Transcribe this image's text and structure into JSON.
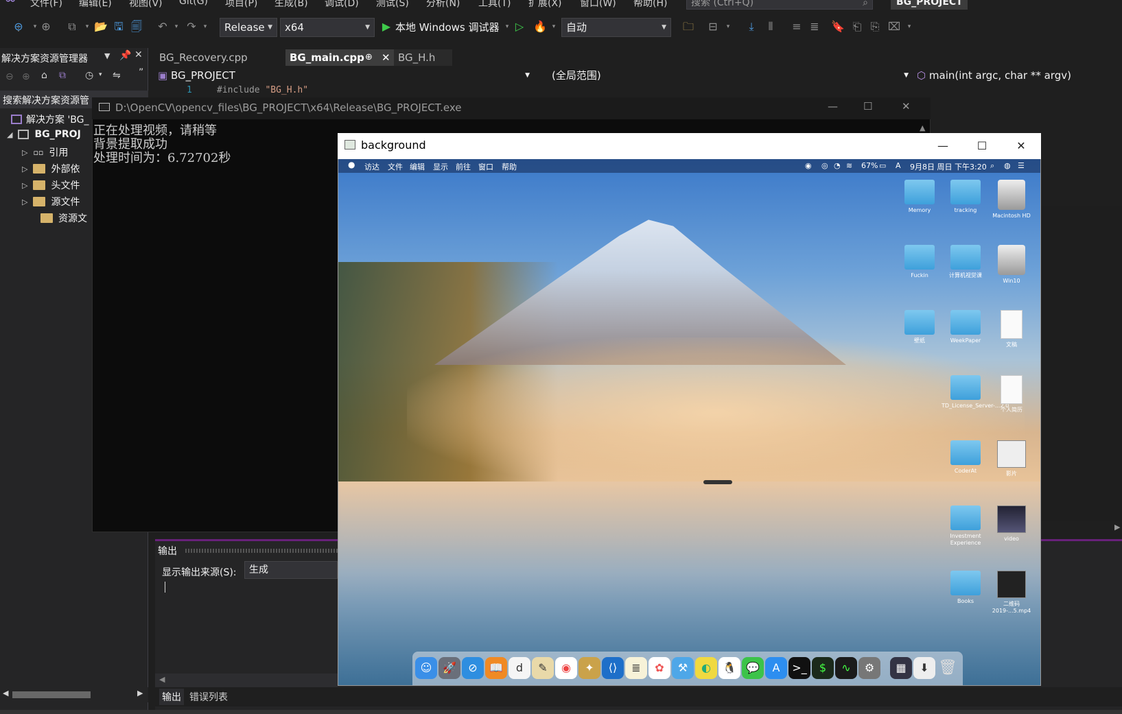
{
  "menu": {
    "items": [
      "文件(F)",
      "编辑(E)",
      "视图(V)",
      "Git(G)",
      "项目(P)",
      "生成(B)",
      "调试(D)",
      "测试(S)",
      "分析(N)",
      "工具(T)",
      "扩展(X)",
      "窗口(W)",
      "帮助(H)"
    ],
    "search_placeholder": "搜索 (Ctrl+Q)",
    "project_name": "BG_PROJECT"
  },
  "toolbar": {
    "config": "Release",
    "platform": "x64",
    "debugger": "本地 Windows 调试器",
    "auto": "自动"
  },
  "solution_explorer": {
    "title": "解决方案资源管理器",
    "search_placeholder": "搜索解决方案资源管",
    "solution": "解决方案 'BG_",
    "project": "BG_PROJ",
    "nodes": [
      "引用",
      "外部依",
      "头文件",
      "源文件",
      "资源文"
    ]
  },
  "editor": {
    "tabs": [
      "BG_Recovery.cpp",
      "BG_main.cpp",
      "BG_H.h"
    ],
    "nav_project": "BG_PROJECT",
    "nav_scope": "(全局范围)",
    "nav_function": "main(int argc, char ** argv)",
    "line_number": "1",
    "code_directive": "#include ",
    "code_string": "\"BG_H.h\""
  },
  "console": {
    "title": "D:\\OpenCV\\opencv_files\\BG_PROJECT\\x64\\Release\\BG_PROJECT.exe",
    "lines": [
      "正在处理视频，请稍等",
      "背景提取成功",
      "处理时间为：6.72702秒"
    ]
  },
  "output": {
    "title": "输出",
    "source_label": "显示输出来源(S):",
    "source_value": "生成",
    "bottom_tabs": [
      "输出",
      "错误列表"
    ]
  },
  "bg_window": {
    "title": "background",
    "mac_menu": [
      "访达",
      "文件",
      "编辑",
      "显示",
      "前往",
      "窗口",
      "帮助"
    ],
    "mac_status": "67%",
    "mac_datetime": "9月8日 周日 下午3:20",
    "desktop_icons": [
      {
        "label": "Memory",
        "kind": "folder"
      },
      {
        "label": "tracking",
        "kind": "folder"
      },
      {
        "label": "Macintosh HD",
        "kind": "disk"
      },
      {
        "label": "Fuckin",
        "kind": "folder"
      },
      {
        "label": "计算机视觉课",
        "kind": "folder"
      },
      {
        "label": "Win10",
        "kind": "disk"
      },
      {
        "label": "壁纸",
        "kind": "folder"
      },
      {
        "label": "WeekPaper",
        "kind": "folder"
      },
      {
        "label": "文稿",
        "kind": "doc"
      },
      {
        "label": "TD_License_Server-...2.0",
        "kind": "folder"
      },
      {
        "label": "个人简历",
        "kind": "doc"
      },
      {
        "label": "CoderAt",
        "kind": "folder"
      },
      {
        "label": "影片",
        "kind": "dark"
      },
      {
        "label": "Investment Experience",
        "kind": "folder"
      },
      {
        "label": "video",
        "kind": "dark"
      },
      {
        "label": "Books",
        "kind": "folder"
      },
      {
        "label": "二维码 2019-...5.mp4",
        "kind": "dark"
      }
    ]
  },
  "colors": {
    "vs_bg": "#1f1f1f",
    "panel_bg": "#252526",
    "accent_purple": "#68217a",
    "run_green": "#3ec94a"
  }
}
